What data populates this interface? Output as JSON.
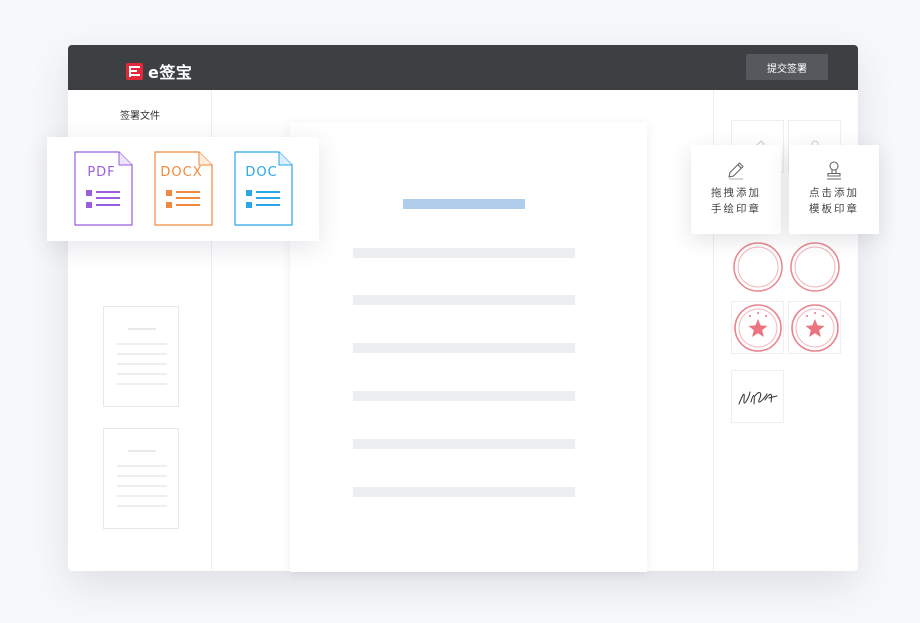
{
  "header": {
    "logo_text": "e签宝",
    "submit_label": "提交签署"
  },
  "left_panel": {
    "title": "签署文件"
  },
  "file_types": [
    {
      "label": "PDF",
      "color": "#9a5fe0"
    },
    {
      "label": "DOCX",
      "color": "#ef8a3e"
    },
    {
      "label": "DOC",
      "color": "#2aa7e8"
    }
  ],
  "actions": {
    "handwritten": {
      "line1": "拖拽添加",
      "line2": "手绘印章",
      "icon": "pencil-icon"
    },
    "template": {
      "line1": "点击添加",
      "line2": "模板印章",
      "icon": "stamp-icon"
    }
  },
  "colors": {
    "titlebar": "#3d4043",
    "brand_red": "#e5273a",
    "seal_red": "#e9868f",
    "doc_title_blue": "#b0cdec"
  }
}
